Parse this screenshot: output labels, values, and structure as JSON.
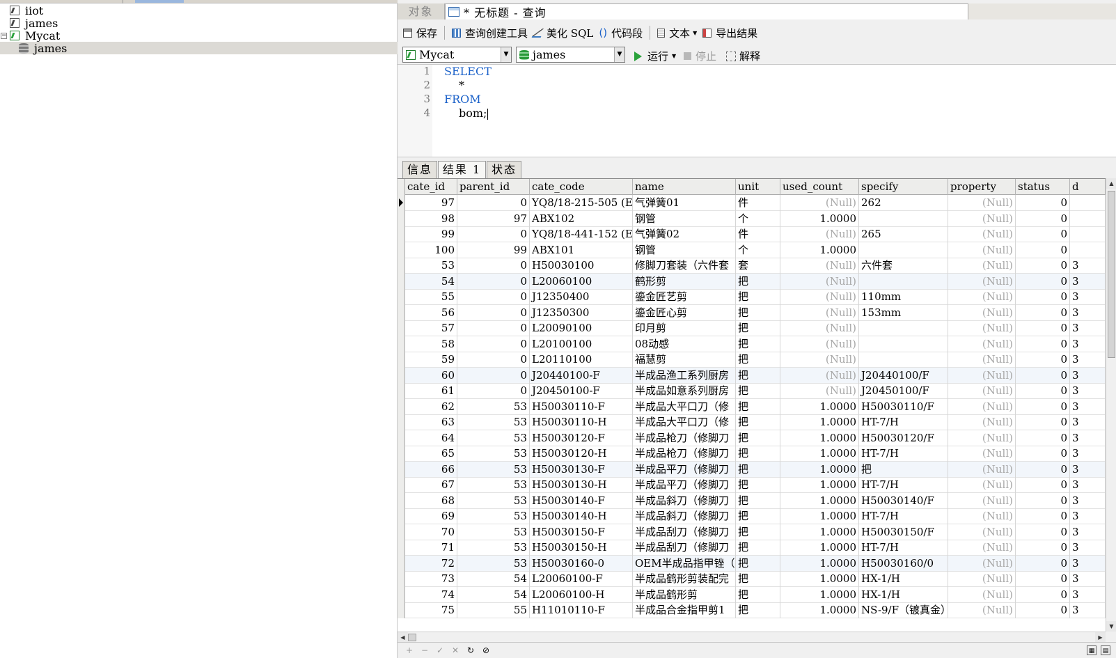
{
  "tree": [
    {
      "label": "iiot",
      "type": "connection",
      "open": false
    },
    {
      "label": "james",
      "type": "connection",
      "open": false
    },
    {
      "label": "Mycat",
      "type": "connection",
      "open": true
    },
    {
      "label": "james",
      "type": "database",
      "selected": true
    }
  ],
  "tabs": {
    "objects": "对象",
    "query": "* 无标题 - 查询"
  },
  "toolbar": {
    "save": "保存",
    "query_builder": "查询创建工具",
    "beautify": "美化 SQL",
    "snippet": "代码段",
    "text": "文本",
    "export": "导出结果"
  },
  "toolbar2": {
    "connection": "Mycat",
    "database": "james",
    "run": "运行",
    "stop": "停止",
    "explain": "解释"
  },
  "editor": {
    "lines": [
      {
        "n": "1",
        "text": "SELECT",
        "kw": true
      },
      {
        "n": "2",
        "text": "*",
        "kw": false
      },
      {
        "n": "3",
        "text": "FROM",
        "kw": true
      },
      {
        "n": "4",
        "text": "bom;",
        "kw": false
      }
    ]
  },
  "result_tabs": [
    "信息",
    "结果 1",
    "状态"
  ],
  "grid": {
    "columns": [
      "cate_id",
      "parent_id",
      "cate_code",
      "name",
      "unit",
      "used_count",
      "specify",
      "property",
      "status",
      "d"
    ],
    "null_text": "(Null)",
    "rows": [
      [
        "97",
        "0",
        "YQ8/18-215-505 (E",
        "气弹簧01",
        "件",
        null,
        "262",
        null,
        "0",
        ""
      ],
      [
        "98",
        "97",
        "ABX102",
        "钢管",
        "个",
        "1.0000",
        "",
        null,
        "0",
        ""
      ],
      [
        "99",
        "0",
        "YQ8/18-441-152 (E",
        "气弹簧02",
        "件",
        null,
        "265",
        null,
        "0",
        ""
      ],
      [
        "100",
        "99",
        "ABX101",
        "钢管",
        "个",
        "1.0000",
        "",
        null,
        "0",
        ""
      ],
      [
        "53",
        "0",
        "H50030100",
        "修脚刀套装（六件套",
        "套",
        null,
        "六件套",
        null,
        "0",
        "3"
      ],
      [
        "54",
        "0",
        "L20060100",
        "鹤形剪",
        "把",
        null,
        "",
        null,
        "0",
        "3"
      ],
      [
        "55",
        "0",
        "J12350400",
        "鎏金匠艺剪",
        "把",
        null,
        "110mm",
        null,
        "0",
        "3"
      ],
      [
        "56",
        "0",
        "J12350300",
        "鎏金匠心剪",
        "把",
        null,
        "153mm",
        null,
        "0",
        "3"
      ],
      [
        "57",
        "0",
        "L20090100",
        "印月剪",
        "把",
        null,
        "",
        null,
        "0",
        "3"
      ],
      [
        "58",
        "0",
        "L20100100",
        "08动感",
        "把",
        null,
        "",
        null,
        "0",
        "3"
      ],
      [
        "59",
        "0",
        "L20110100",
        "福慧剪",
        "把",
        null,
        "",
        null,
        "0",
        "3"
      ],
      [
        "60",
        "0",
        "J20440100-F",
        "半成品渔工系列厨房",
        "把",
        null,
        "J20440100/F",
        null,
        "0",
        "3"
      ],
      [
        "61",
        "0",
        "J20450100-F",
        "半成品如意系列厨房",
        "把",
        null,
        "J20450100/F",
        null,
        "0",
        "3"
      ],
      [
        "62",
        "53",
        "H50030110-F",
        "半成品大平口刀（修",
        "把",
        "1.0000",
        "H50030110/F",
        null,
        "0",
        "3"
      ],
      [
        "63",
        "53",
        "H50030110-H",
        "半成品大平口刀（修",
        "把",
        "1.0000",
        "HT-7/H",
        null,
        "0",
        "3"
      ],
      [
        "64",
        "53",
        "H50030120-F",
        "半成品枪刀（修脚刀",
        "把",
        "1.0000",
        "H50030120/F",
        null,
        "0",
        "3"
      ],
      [
        "65",
        "53",
        "H50030120-H",
        "半成品枪刀（修脚刀",
        "把",
        "1.0000",
        "HT-7/H",
        null,
        "0",
        "3"
      ],
      [
        "66",
        "53",
        "H50030130-F",
        "半成品平刀（修脚刀",
        "把",
        "1.0000",
        "把",
        null,
        "0",
        "3"
      ],
      [
        "67",
        "53",
        "H50030130-H",
        "半成品平刀（修脚刀",
        "把",
        "1.0000",
        "HT-7/H",
        null,
        "0",
        "3"
      ],
      [
        "68",
        "53",
        "H50030140-F",
        "半成品斜刀（修脚刀",
        "把",
        "1.0000",
        "H50030140/F",
        null,
        "0",
        "3"
      ],
      [
        "69",
        "53",
        "H50030140-H",
        "半成品斜刀（修脚刀",
        "把",
        "1.0000",
        "HT-7/H",
        null,
        "0",
        "3"
      ],
      [
        "70",
        "53",
        "H50030150-F",
        "半成品刮刀（修脚刀",
        "把",
        "1.0000",
        "H50030150/F",
        null,
        "0",
        "3"
      ],
      [
        "71",
        "53",
        "H50030150-H",
        "半成品刮刀（修脚刀",
        "把",
        "1.0000",
        "HT-7/H",
        null,
        "0",
        "3"
      ],
      [
        "72",
        "53",
        "H50030160-0",
        "OEM半成品指甲锉（",
        "把",
        "1.0000",
        "H50030160/0",
        null,
        "0",
        "3"
      ],
      [
        "73",
        "54",
        "L20060100-F",
        "半成品鹤形剪装配完",
        "把",
        "1.0000",
        "HX-1/H",
        null,
        "0",
        "3"
      ],
      [
        "74",
        "54",
        "L20060100-H",
        "半成品鹤形剪",
        "把",
        "1.0000",
        "HX-1/H",
        null,
        "0",
        "3"
      ],
      [
        "75",
        "55",
        "H11010110-F",
        "半成品合金指甲剪1",
        "把",
        "1.0000",
        "NS-9/F（镀真金）",
        null,
        "0",
        "3"
      ]
    ]
  }
}
